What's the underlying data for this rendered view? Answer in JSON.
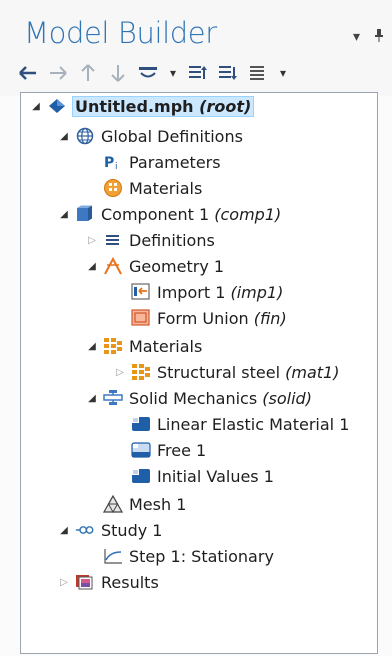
{
  "panel": {
    "title": "Model Builder",
    "title_menu_icon": "dropdown-triangle-icon",
    "pin_icon": "pin-icon"
  },
  "toolbar": {
    "items": [
      {
        "icon": "arrow-left-icon",
        "glyph": "←",
        "enabled": true
      },
      {
        "icon": "arrow-right-icon",
        "glyph": "→",
        "enabled": false
      },
      {
        "icon": "arrow-up-icon",
        "glyph": "↑",
        "enabled": false
      },
      {
        "icon": "arrow-down-icon",
        "glyph": "↓",
        "enabled": false
      },
      {
        "icon": "show-icon",
        "glyph": "▼",
        "enabled": true
      },
      {
        "icon": "collapse-all-icon",
        "glyph": "≣",
        "enabled": true
      },
      {
        "icon": "expand-all-icon",
        "glyph": "≣",
        "enabled": true
      },
      {
        "icon": "list-menu-icon",
        "glyph": "≡",
        "enabled": true
      }
    ]
  },
  "tree": {
    "nodes": [
      {
        "label": "Untitled.mph",
        "tag": "(root)",
        "icon": "model-root-icon",
        "toggle": "open",
        "selected": true
      },
      {
        "label": "Global Definitions",
        "tag": "",
        "icon": "globe-icon",
        "toggle": "open"
      },
      {
        "label": "Parameters",
        "tag": "",
        "icon": "parameters-icon",
        "toggle": "none"
      },
      {
        "label": "Materials",
        "tag": "",
        "icon": "global-materials-icon",
        "toggle": "none"
      },
      {
        "label": "Component 1",
        "tag": "(comp1)",
        "icon": "component-icon",
        "toggle": "open"
      },
      {
        "label": "Definitions",
        "tag": "",
        "icon": "definitions-icon",
        "toggle": "closed"
      },
      {
        "label": "Geometry 1",
        "tag": "",
        "icon": "geometry-icon",
        "toggle": "open"
      },
      {
        "label": "Import 1",
        "tag": "(imp1)",
        "icon": "import-icon",
        "toggle": "none"
      },
      {
        "label": "Form Union",
        "tag": "(fin)",
        "icon": "form-union-icon",
        "toggle": "none"
      },
      {
        "label": "Materials",
        "tag": "",
        "icon": "materials-icon",
        "toggle": "open"
      },
      {
        "label": "Structural steel",
        "tag": "(mat1)",
        "icon": "material-icon",
        "toggle": "closed"
      },
      {
        "label": "Solid Mechanics",
        "tag": "(solid)",
        "icon": "solid-mechanics-icon",
        "toggle": "open"
      },
      {
        "label": "Linear Elastic Material 1",
        "tag": "",
        "icon": "domain-node-icon",
        "toggle": "none"
      },
      {
        "label": "Free 1",
        "tag": "",
        "icon": "boundary-node-icon",
        "toggle": "none"
      },
      {
        "label": "Initial Values 1",
        "tag": "",
        "icon": "domain-node-icon",
        "toggle": "none"
      },
      {
        "label": "Mesh 1",
        "tag": "",
        "icon": "mesh-icon",
        "toggle": "none"
      },
      {
        "label": "Study 1",
        "tag": "",
        "icon": "study-icon",
        "toggle": "open"
      },
      {
        "label": "Step 1: Stationary",
        "tag": "",
        "icon": "stationary-step-icon",
        "toggle": "none"
      },
      {
        "label": "Results",
        "tag": "",
        "icon": "results-icon",
        "toggle": "closed"
      }
    ]
  },
  "colors": {
    "title": "#2f74b5",
    "selection_bg": "#cce8ff",
    "accent_orange": "#e8731a",
    "accent_blue": "#1f5fa8"
  }
}
